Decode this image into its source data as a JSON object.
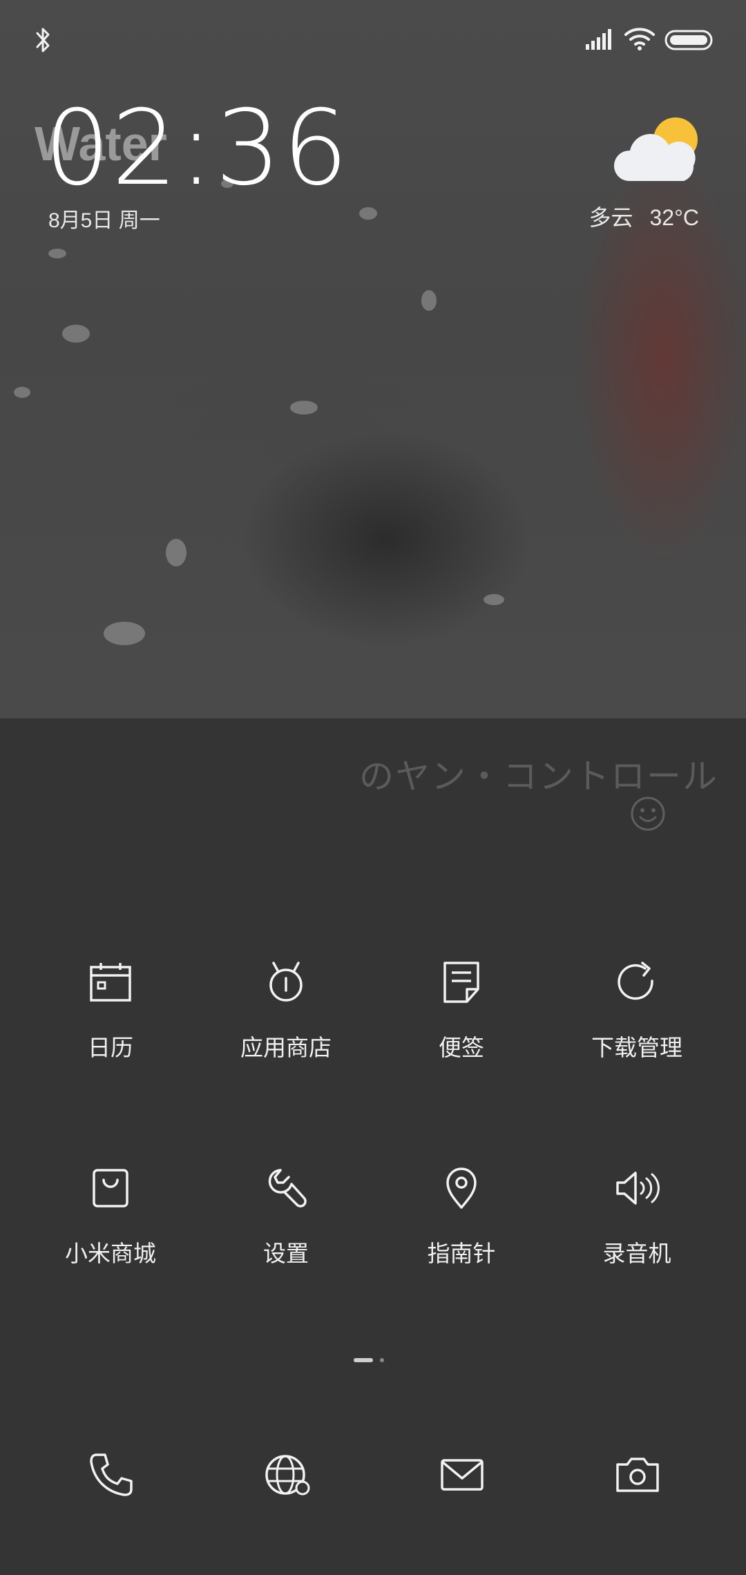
{
  "wallpaper": {
    "overlay_word": "Water"
  },
  "status_bar": {
    "icons": [
      "bluetooth-icon",
      "signal-icon",
      "wifi-icon",
      "battery-icon"
    ]
  },
  "lock_clock": {
    "time": "02:36",
    "date": "8月5日 周一"
  },
  "weather": {
    "icon": "partly-cloudy-icon",
    "condition": "多云",
    "temperature": "32°C"
  },
  "signature": {
    "text": "のヤン・コントロール",
    "emoji_icon": "smiley-icon"
  },
  "apps": [
    {
      "label": "日历",
      "icon": "calendar-icon"
    },
    {
      "label": "应用商店",
      "icon": "app-store-icon"
    },
    {
      "label": "便签",
      "icon": "notes-icon"
    },
    {
      "label": "下载管理",
      "icon": "download-manager-icon"
    },
    {
      "label": "小米商城",
      "icon": "mi-store-bag-icon"
    },
    {
      "label": "设置",
      "icon": "settings-wrench-icon"
    },
    {
      "label": "指南针",
      "icon": "compass-location-icon"
    },
    {
      "label": "录音机",
      "icon": "recorder-speaker-icon"
    }
  ],
  "page_indicator": {
    "pages": 2,
    "current": 1
  },
  "dock": [
    {
      "icon": "phone-icon"
    },
    {
      "icon": "browser-globe-icon"
    },
    {
      "icon": "messages-envelope-icon"
    },
    {
      "icon": "camera-icon"
    }
  ],
  "colors": {
    "background": "#343434",
    "wallpaper": "#4a4a4a",
    "foreground": "#f2f2f2",
    "sun": "#f7c23a",
    "cloud": "#eef0f3"
  }
}
